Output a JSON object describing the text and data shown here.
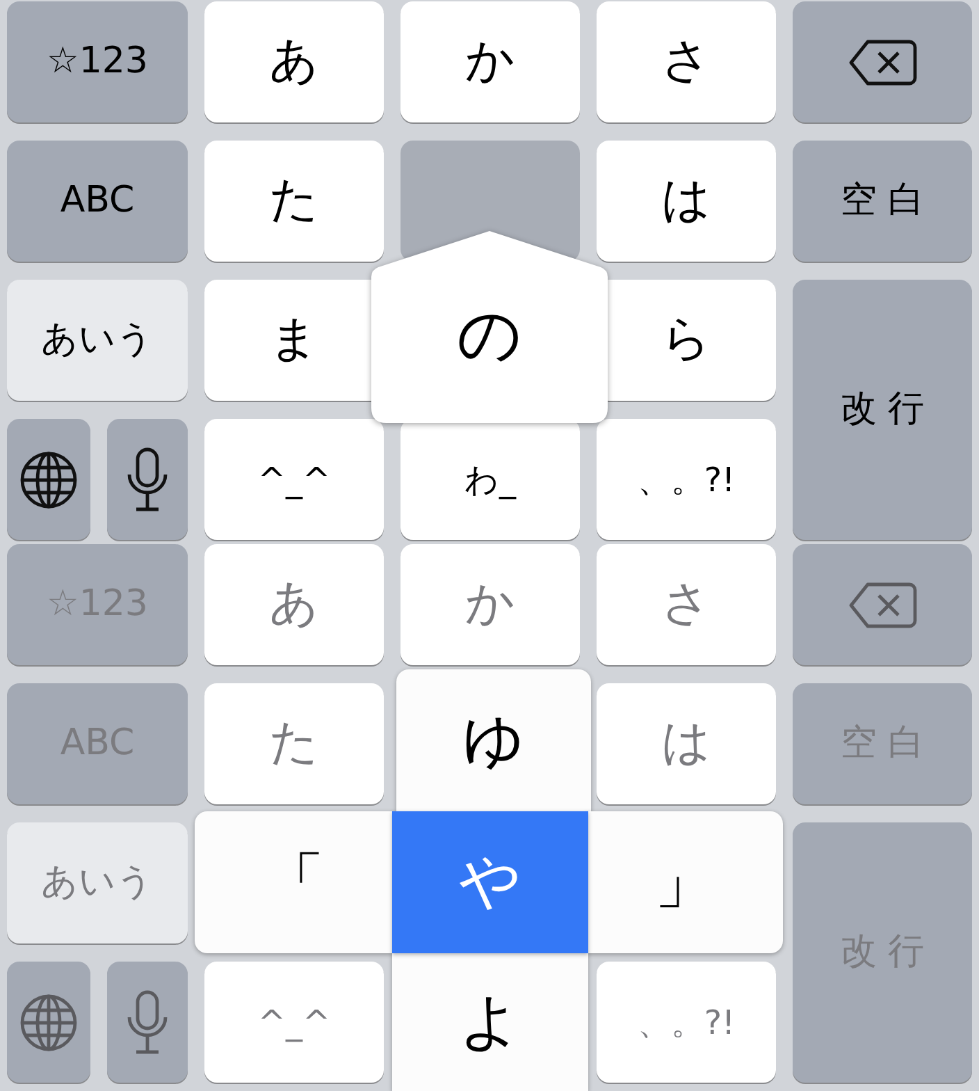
{
  "keyboards": [
    {
      "dimmed": false,
      "keys": [
        {
          "kind": "mode",
          "label": "☆123",
          "selected": false
        },
        {
          "kind": "letter",
          "label": "あ"
        },
        {
          "kind": "letter",
          "label": "か"
        },
        {
          "kind": "letter",
          "label": "さ"
        },
        {
          "kind": "backspace"
        },
        {
          "kind": "mode",
          "label": "ABC",
          "selected": false
        },
        {
          "kind": "letter",
          "label": "た"
        },
        {
          "kind": "pressed"
        },
        {
          "kind": "letter",
          "label": "は"
        },
        {
          "kind": "action",
          "label": "空白"
        },
        {
          "kind": "mode",
          "label": "あいう",
          "selected": true
        },
        {
          "kind": "letter",
          "label": "ま"
        },
        {
          "kind": "covered"
        },
        {
          "kind": "letter",
          "label": "ら"
        },
        {
          "kind": "return",
          "label": "改行"
        },
        {
          "kind": "globe"
        },
        {
          "kind": "mic"
        },
        {
          "kind": "letter",
          "label": "^_^"
        },
        {
          "kind": "letter",
          "label": "わ_"
        },
        {
          "kind": "letter",
          "label": "、。?!"
        }
      ],
      "popup": {
        "kind": "single",
        "label": "の"
      }
    },
    {
      "dimmed": true,
      "keys": [
        {
          "kind": "mode",
          "label": "☆123",
          "selected": false
        },
        {
          "kind": "letter",
          "label": "あ"
        },
        {
          "kind": "letter",
          "label": "か"
        },
        {
          "kind": "letter",
          "label": "さ"
        },
        {
          "kind": "backspace"
        },
        {
          "kind": "mode",
          "label": "ABC",
          "selected": false
        },
        {
          "kind": "letter",
          "label": "た"
        },
        {
          "kind": "covered"
        },
        {
          "kind": "letter",
          "label": "は"
        },
        {
          "kind": "action",
          "label": "空白"
        },
        {
          "kind": "mode",
          "label": "あいう",
          "selected": true
        },
        {
          "kind": "covered"
        },
        {
          "kind": "covered"
        },
        {
          "kind": "covered"
        },
        {
          "kind": "return",
          "label": "改行"
        },
        {
          "kind": "globe"
        },
        {
          "kind": "mic"
        },
        {
          "kind": "letter",
          "label": "^_^"
        },
        {
          "kind": "covered"
        },
        {
          "kind": "letter",
          "label": "、。?!"
        }
      ],
      "popup": {
        "kind": "flick",
        "options": [
          {
            "kind": "up",
            "label": "ゆ",
            "selected": false
          },
          {
            "kind": "left",
            "label": "「",
            "selected": false
          },
          {
            "kind": "center",
            "label": "や",
            "selected": true
          },
          {
            "kind": "right",
            "label": "」",
            "selected": false
          },
          {
            "kind": "down",
            "label": "よ",
            "selected": false
          }
        ]
      }
    }
  ]
}
